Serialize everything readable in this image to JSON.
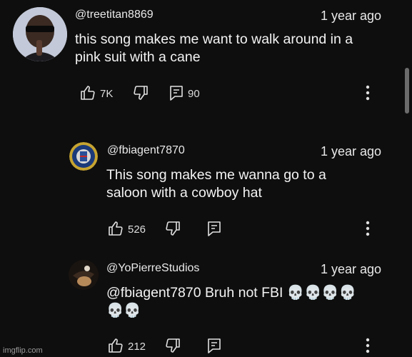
{
  "comment": {
    "handle": "@treetitan8869",
    "time": "1 year ago",
    "line1": "this song makes me want to walk around in a",
    "line2": "pink suit with a cane",
    "likes": "7K",
    "replies": "90"
  },
  "reply1": {
    "handle": "@fbiagent7870",
    "time": "1 year ago",
    "line1": "This song makes me wanna go to a",
    "line2": "saloon with a cowboy hat",
    "likes": "526"
  },
  "reply2": {
    "handle": "@YoPierreStudios",
    "time": "1 year ago",
    "line1": "@fbiagent7870 Bruh not FBI 💀💀💀💀",
    "line2": "💀💀",
    "likes": "212"
  },
  "watermark": "imgflip.com",
  "icons": [
    "like-icon",
    "dislike-icon",
    "reply-icon",
    "more-icon"
  ]
}
